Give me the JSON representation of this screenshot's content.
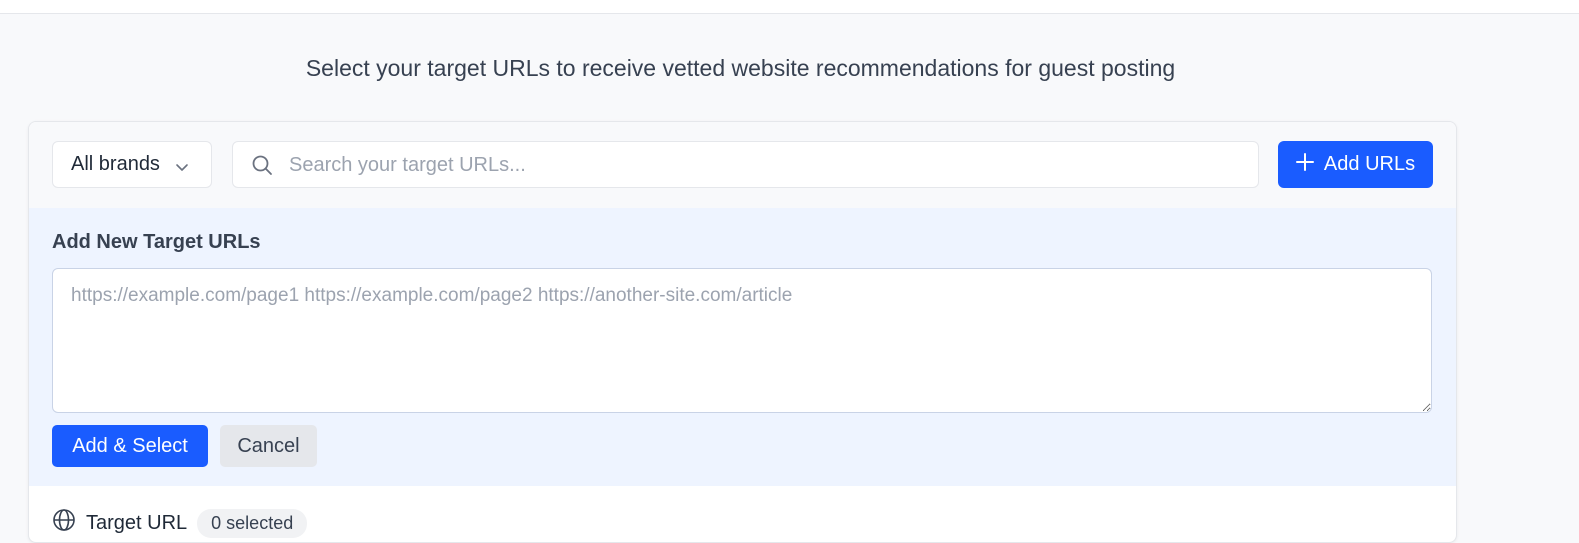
{
  "header": {
    "subtitle": "Select your target URLs to receive vetted website recommendations for guest posting"
  },
  "toolbar": {
    "brand_filter": {
      "selected": "All brands",
      "icon": "chevron-down-icon"
    },
    "search": {
      "placeholder": "Search your target URLs...",
      "value": "",
      "icon": "search-icon"
    },
    "add_urls_label": "Add URLs",
    "add_urls_icon": "plus-icon"
  },
  "add_panel": {
    "title": "Add New Target URLs",
    "textarea_placeholder": "https://example.com/page1 https://example.com/page2 https://another-site.com/article",
    "textarea_value": "",
    "add_select_label": "Add & Select",
    "cancel_label": "Cancel"
  },
  "list": {
    "column_label": "Target URL",
    "badge": "0 selected",
    "icon": "globe-icon"
  },
  "colors": {
    "accent": "#1a5cff",
    "panel_bg": "#eef4ff",
    "page_bg": "#f8f9fb"
  }
}
